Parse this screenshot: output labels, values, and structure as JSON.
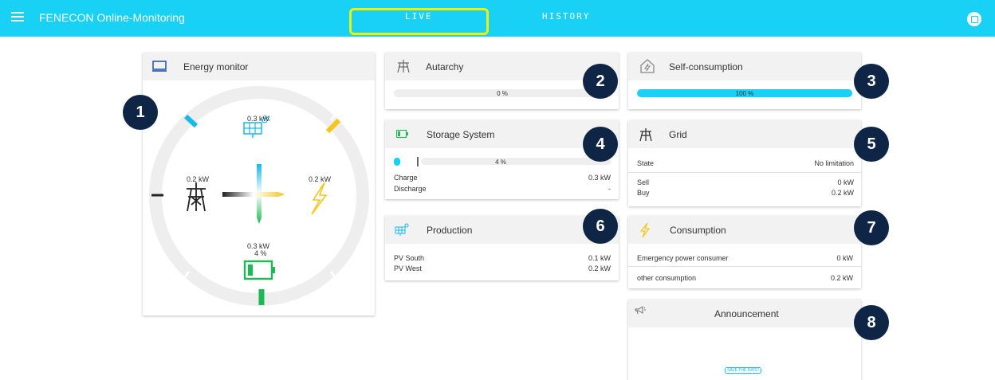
{
  "header": {
    "app_title": "FENECON Online-Monitoring",
    "tabs": [
      {
        "label": "LIVE"
      },
      {
        "label": "HISTORY"
      }
    ]
  },
  "energy_monitor": {
    "title": "Energy monitor",
    "production_value": "0.3 kW",
    "grid_value": "0.2 kW",
    "consumption_value": "0.2 kW",
    "storage_value": "0.3 kW",
    "storage_soc": "4 %"
  },
  "autarchy": {
    "title": "Autarchy",
    "value_label": "0 %",
    "value": 0
  },
  "self_consumption": {
    "title": "Self-consumption",
    "value_label": "100 %",
    "value": 100
  },
  "storage": {
    "title": "Storage System",
    "soc_label": "4 %",
    "soc": 4,
    "rows": [
      {
        "label": "Charge",
        "value": "0.3 kW"
      },
      {
        "label": "Discharge",
        "value": "-"
      }
    ]
  },
  "grid": {
    "title": "Grid",
    "state_label": "State",
    "state_value": "No limitation",
    "rows": [
      {
        "label": "Sell",
        "value": "0 kW"
      },
      {
        "label": "Buy",
        "value": "0.2 kW"
      }
    ]
  },
  "production": {
    "title": "Production",
    "rows": [
      {
        "label": "PV South",
        "value": "0.1 kW"
      },
      {
        "label": "PV West",
        "value": "0.2 kW"
      }
    ]
  },
  "consumption": {
    "title": "Consumption",
    "rows": [
      {
        "label": "Emergency power consumer",
        "value": "0 kW"
      },
      {
        "label": "other consumption",
        "value": "0.2 kW"
      }
    ]
  },
  "announcement": {
    "title": "Announcement",
    "stamp": "SAVE THE DATE!"
  },
  "badges": [
    "1",
    "2",
    "3",
    "4",
    "5",
    "6",
    "7",
    "8"
  ],
  "colors": {
    "accent": "#18d1f5",
    "highlight": "#ecf20c",
    "badge": "#0f2545",
    "production": "#18b8e8",
    "consumption": "#f5c518",
    "storage": "#1db954",
    "grid": "#222222"
  },
  "icons": {
    "menu": "hamburger-icon",
    "avatar": "user-icon",
    "monitor": "monitor-icon",
    "autarchy": "power-tower-icon",
    "self_consumption": "home-bolt-icon",
    "storage": "battery-icon",
    "grid": "power-tower-icon",
    "production": "solar-panel-icon",
    "consumption": "lightning-icon",
    "announcement": "megaphone-icon"
  }
}
